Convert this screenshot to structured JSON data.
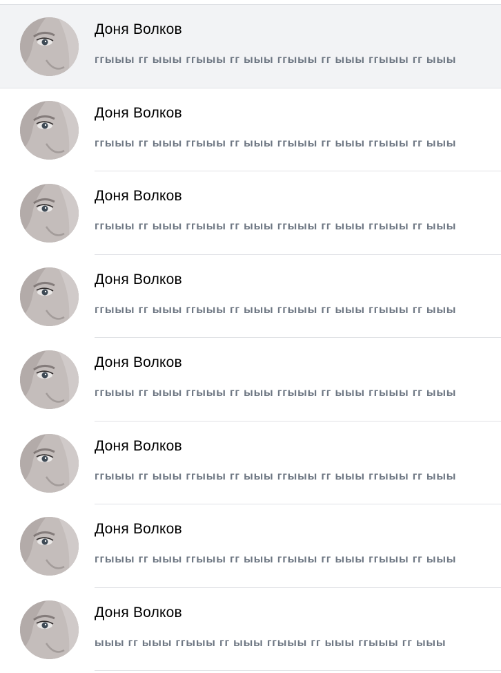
{
  "chats": [
    {
      "name": "Доня Волков",
      "preview": "ггыыы гг ыыы ггыыы гг ыыы ггыыы гг ыыы ггыыы гг ыыы",
      "selected": true,
      "avatar": "user-avatar"
    },
    {
      "name": "Доня Волков",
      "preview": "ггыыы гг ыыы ггыыы гг ыыы ггыыы гг ыыы ггыыы гг ыыы",
      "selected": false,
      "avatar": "user-avatar"
    },
    {
      "name": "Доня Волков",
      "preview": "ггыыы гг ыыы ггыыы гг ыыы ггыыы гг ыыы ггыыы гг ыыы",
      "selected": false,
      "avatar": "user-avatar"
    },
    {
      "name": "Доня Волков",
      "preview": "ггыыы гг ыыы ггыыы гг ыыы ггыыы гг ыыы ггыыы гг ыыы",
      "selected": false,
      "avatar": "user-avatar"
    },
    {
      "name": "Доня Волков",
      "preview": "ггыыы гг ыыы ггыыы гг ыыы ггыыы гг ыыы ггыыы гг ыыы",
      "selected": false,
      "avatar": "user-avatar"
    },
    {
      "name": "Доня Волков",
      "preview": "ггыыы гг ыыы ггыыы гг ыыы ггыыы гг ыыы ггыыы гг ыыы",
      "selected": false,
      "avatar": "user-avatar"
    },
    {
      "name": "Доня Волков",
      "preview": "ггыыы гг ыыы ггыыы гг ыыы ггыыы гг ыыы ггыыы гг ыыы",
      "selected": false,
      "avatar": "user-avatar"
    },
    {
      "name": "Доня Волков",
      "preview": "ыыы гг ыыы ггыыы гг ыыы ггыыы гг ыыы ггыыы гг ыыы",
      "selected": false,
      "avatar": "user-avatar"
    }
  ],
  "colors": {
    "selected_bg": "#f2f3f5",
    "divider": "#dfe1e5",
    "name_text": "#000000",
    "preview_text": "#6e7783"
  }
}
